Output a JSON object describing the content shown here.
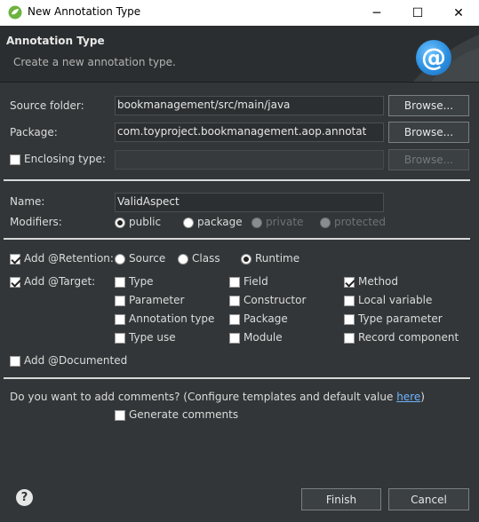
{
  "window": {
    "title": "New Annotation Type",
    "minimize_glyph": "─",
    "maximize_glyph": "☐",
    "close_glyph": "✕"
  },
  "banner": {
    "heading": "Annotation Type",
    "subtitle": "Create a new annotation type.",
    "icon_glyph": "@"
  },
  "source_folder": {
    "label": "Source folder:",
    "value": "bookmanagement/src/main/java",
    "browse": "Browse..."
  },
  "package": {
    "label": "Package:",
    "value": "com.toyproject.bookmanagement.aop.annotat",
    "browse": "Browse..."
  },
  "enclosing_type": {
    "label": "Enclosing type:",
    "value": "",
    "browse": "Browse...",
    "checked": false
  },
  "name": {
    "label": "Name:",
    "value": "ValidAspect"
  },
  "modifiers": {
    "label": "Modifiers:",
    "options": [
      "public",
      "package",
      "private",
      "protected"
    ],
    "selected": "public"
  },
  "retention": {
    "label": "Add @Retention:",
    "checked": true,
    "options": [
      "Source",
      "Class",
      "Runtime"
    ],
    "selected": "Runtime"
  },
  "target": {
    "label": "Add @Target:",
    "checked": true,
    "col1": [
      "Type",
      "Parameter",
      "Annotation type",
      "Type use"
    ],
    "col2": [
      "Field",
      "Constructor",
      "Package",
      "Module"
    ],
    "col3": [
      "Method",
      "Local variable",
      "Type parameter",
      "Record component"
    ],
    "checked_items": [
      "Method"
    ]
  },
  "documented": {
    "label": "Add @Documented",
    "checked": false
  },
  "comments": {
    "question": "Do you want to add comments? (Configure templates and default value ",
    "link": "here",
    "close_paren": ")",
    "generate_label": "Generate comments",
    "generate_checked": false
  },
  "footer": {
    "help_glyph": "?",
    "finish": "Finish",
    "cancel": "Cancel"
  }
}
